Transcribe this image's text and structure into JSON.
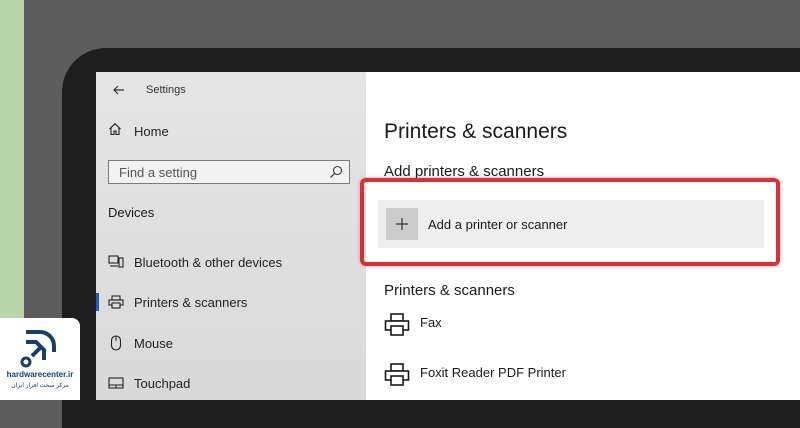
{
  "window": {
    "title": "Settings"
  },
  "sidebar": {
    "home_label": "Home",
    "search_placeholder": "Find a setting",
    "section_label": "Devices",
    "items": [
      {
        "label": "Bluetooth & other devices",
        "icon": "bluetooth-device-icon",
        "selected": false
      },
      {
        "label": "Printers & scanners",
        "icon": "printer-icon",
        "selected": true
      },
      {
        "label": "Mouse",
        "icon": "mouse-icon",
        "selected": false
      },
      {
        "label": "Touchpad",
        "icon": "touchpad-icon",
        "selected": false
      }
    ]
  },
  "main": {
    "page_title": "Printers & scanners",
    "add_section_heading": "Add printers & scanners",
    "add_button_label": "Add a printer or scanner",
    "list_heading": "Printers & scanners",
    "printers": [
      {
        "name": "Fax",
        "icon": "printer-icon"
      },
      {
        "name": "Foxit Reader PDF Printer",
        "icon": "printer-icon"
      }
    ]
  },
  "logo": {
    "name": "hardwarecenter.ir",
    "subtitle": "مرکز سخت افزار ایران"
  },
  "colors": {
    "accent": "#1d5fbf",
    "highlight": "#d63235",
    "sidebar_bg": "#e0e0e0"
  }
}
